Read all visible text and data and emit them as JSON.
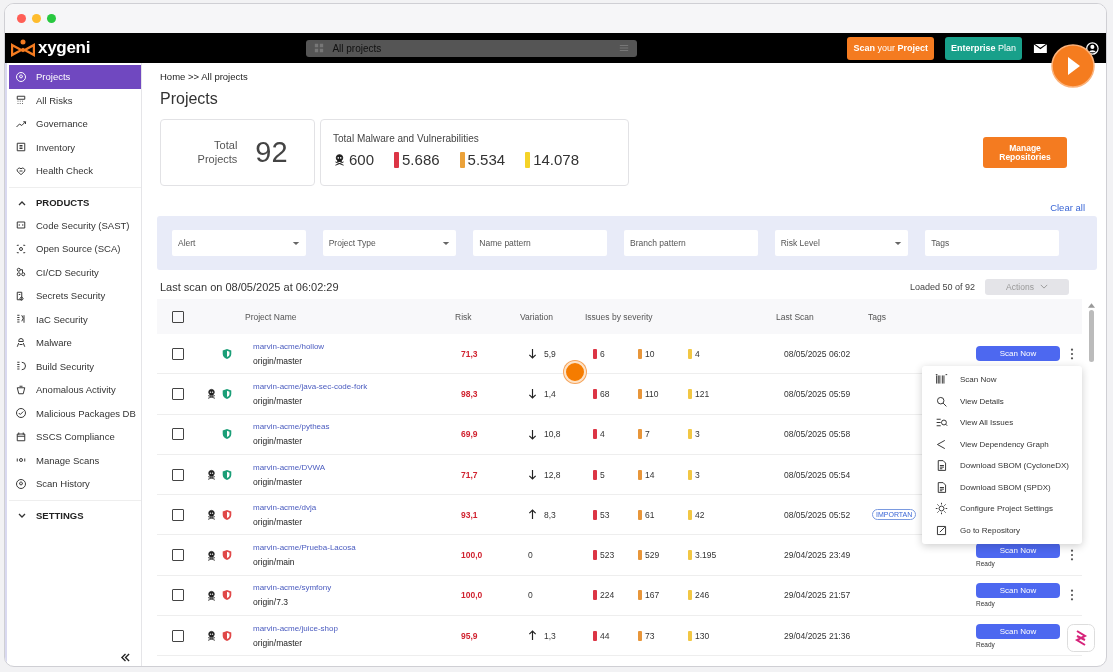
{
  "topbar": {
    "logo": "xygeni",
    "search": {
      "value": "All projects"
    },
    "buttons": [
      {
        "label": "**Scan** your **Project**",
        "kind": "orange"
      },
      {
        "label": "**Enterprise** Plan",
        "kind": "green"
      }
    ]
  },
  "sidebar": {
    "items": [
      {
        "label": "Projects",
        "selected": true
      },
      {
        "label": "All Risks",
        "selected": false
      },
      {
        "label": "Governance",
        "selected": false
      },
      {
        "label": "Inventory",
        "selected": false
      },
      {
        "label": "Health Check",
        "selected": false
      }
    ],
    "sections": [
      {
        "title": "PRODUCTS",
        "expanded": true,
        "items": [
          {
            "label": "Code Security (SAST)",
            "selected": false
          },
          {
            "label": "Open Source (SCA)",
            "selected": false
          },
          {
            "label": "CI/CD Security",
            "selected": false
          },
          {
            "label": "Secrets Security",
            "selected": false
          },
          {
            "label": "IaC Security",
            "selected": false
          },
          {
            "label": "Malware",
            "selected": false
          },
          {
            "label": "Build Security",
            "selected": false
          },
          {
            "label": "Anomalous Activity",
            "selected": false
          },
          {
            "label": "Malicious Packages DB",
            "selected": false
          },
          {
            "label": "SSCS Compliance",
            "selected": false
          },
          {
            "label": "Manage Scans",
            "selected": false
          },
          {
            "label": "Scan History",
            "selected": false
          }
        ]
      },
      {
        "title": "SETTINGS",
        "expanded": false
      }
    ]
  },
  "breadcrumb": "Home >> All projects",
  "title": "Projects",
  "total_projects": {
    "label": "Total Projects",
    "value": "92"
  },
  "totals": {
    "title": "Total Malware and Vulnerabilities",
    "malware": "600",
    "counts": [
      {
        "value": "5.686",
        "color": "#dc3545"
      },
      {
        "value": "5.534",
        "color": "#eba23a"
      },
      {
        "value": "14.078",
        "color": "#f5d328"
      }
    ]
  },
  "manage_button": "Manage Repositories",
  "clear_all": "Clear all",
  "filters": [
    {
      "kind": "select",
      "label": "Alert"
    },
    {
      "kind": "select",
      "label": "Project Type"
    },
    {
      "kind": "text",
      "placeholder": "Name pattern"
    },
    {
      "kind": "text",
      "placeholder": "Branch pattern"
    },
    {
      "kind": "select",
      "label": "Risk Level"
    },
    {
      "kind": "text",
      "placeholder": "Tags"
    }
  ],
  "last_scan": "Last scan on 08/05/2025 at 06:02:29",
  "loaded": "Loaded 50 of 92",
  "actions_button": {
    "label": "Actions",
    "disabled": true
  },
  "table": {
    "select_all": {
      "checked": false
    },
    "columns": [
      "Project Name",
      "Risk",
      "Variation",
      "Issues by severity",
      "Last Scan",
      "Tags"
    ],
    "rows": [
      {
        "checked": false,
        "malware": false,
        "shield": {
          "color": "#1a9e77"
        },
        "name": "marvin-acme/hollow",
        "branch": "origin/master",
        "risk": "71,3",
        "variation": {
          "kind": "down",
          "value": "5,9"
        },
        "issues": [
          {
            "count": "6",
            "color": "#dc3545"
          },
          {
            "count": "10",
            "color": "#e8963a"
          },
          {
            "count": "4",
            "color": "#f2c744"
          }
        ],
        "last_scan": "08/05/2025 06:02",
        "action": {
          "label": "Scan Now"
        }
      },
      {
        "checked": false,
        "malware": true,
        "shield": {
          "color": "#1a9e77"
        },
        "name": "marvin-acme/java-sec-code-fork",
        "branch": "origin/master",
        "risk": "98,3",
        "variation": {
          "kind": "down",
          "value": "1,4"
        },
        "issues": [
          {
            "count": "68",
            "color": "#dc3545"
          },
          {
            "count": "110",
            "color": "#e8963a"
          },
          {
            "count": "121",
            "color": "#f2c744"
          }
        ],
        "last_scan": "08/05/2025 05:59"
      },
      {
        "checked": false,
        "malware": false,
        "shield": {
          "color": "#1a9e77"
        },
        "name": "marvin-acme/pytheas",
        "branch": "origin/master",
        "risk": "69,9",
        "variation": {
          "kind": "down",
          "value": "10,8"
        },
        "issues": [
          {
            "count": "4",
            "color": "#dc3545"
          },
          {
            "count": "7",
            "color": "#e8963a"
          },
          {
            "count": "3",
            "color": "#f2c744"
          }
        ],
        "last_scan": "08/05/2025 05:58"
      },
      {
        "checked": false,
        "malware": true,
        "shield": {
          "color": "#1a9e77"
        },
        "name": "marvin-acme/DVWA",
        "branch": "origin/master",
        "risk": "71,7",
        "variation": {
          "kind": "down",
          "value": "12,8"
        },
        "issues": [
          {
            "count": "5",
            "color": "#dc3545"
          },
          {
            "count": "14",
            "color": "#e8963a"
          },
          {
            "count": "3",
            "color": "#f2c744"
          }
        ],
        "last_scan": "08/05/2025 05:54"
      },
      {
        "checked": false,
        "malware": true,
        "shield": {
          "color": "#e04848"
        },
        "name": "marvin-acme/dvja",
        "branch": "origin/master",
        "risk": "93,1",
        "variation": {
          "kind": "up",
          "value": "8,3"
        },
        "issues": [
          {
            "count": "53",
            "color": "#dc3545"
          },
          {
            "count": "61",
            "color": "#e8963a"
          },
          {
            "count": "42",
            "color": "#f2c744"
          }
        ],
        "last_scan": "08/05/2025 05:52",
        "tags": [
          "IMPORTAN"
        ]
      },
      {
        "checked": false,
        "malware": true,
        "shield": {
          "color": "#e04848"
        },
        "name": "marvin-acme/Prueba-Lacosa",
        "branch": "origin/main",
        "risk": "100,0",
        "variation": {
          "kind": "none",
          "value": "0"
        },
        "issues": [
          {
            "count": "523",
            "color": "#dc3545"
          },
          {
            "count": "529",
            "color": "#e8963a"
          },
          {
            "count": "3.195",
            "color": "#f2c744"
          }
        ],
        "last_scan": "29/04/2025 23:49",
        "action": {
          "label": "Scan Now",
          "status": "Ready"
        }
      },
      {
        "checked": false,
        "malware": true,
        "shield": {
          "color": "#e04848"
        },
        "name": "marvin-acme/symfony",
        "branch": "origin/7.3",
        "risk": "100,0",
        "variation": {
          "kind": "none",
          "value": "0"
        },
        "issues": [
          {
            "count": "224",
            "color": "#dc3545"
          },
          {
            "count": "167",
            "color": "#e8963a"
          },
          {
            "count": "246",
            "color": "#f2c744"
          }
        ],
        "last_scan": "29/04/2025 21:57",
        "action": {
          "label": "Scan Now",
          "status": "Ready"
        }
      },
      {
        "checked": false,
        "malware": true,
        "shield": {
          "color": "#e04848"
        },
        "name": "marvin-acme/juice-shop",
        "branch": "origin/master",
        "risk": "95,9",
        "variation": {
          "kind": "up",
          "value": "1,3"
        },
        "issues": [
          {
            "count": "44",
            "color": "#dc3545"
          },
          {
            "count": "73",
            "color": "#e8963a"
          },
          {
            "count": "130",
            "color": "#f2c744"
          }
        ],
        "last_scan": "29/04/2025 21:36",
        "action": {
          "label": "Scan Now",
          "status": "Ready"
        }
      }
    ]
  },
  "row_menu": [
    "Scan Now",
    "View Details",
    "View All Issues",
    "View Dependency Graph",
    "Download SBOM (CycloneDX)",
    "Download SBOM (SPDX)",
    "Configure Project Settings",
    "Go to Repository"
  ]
}
